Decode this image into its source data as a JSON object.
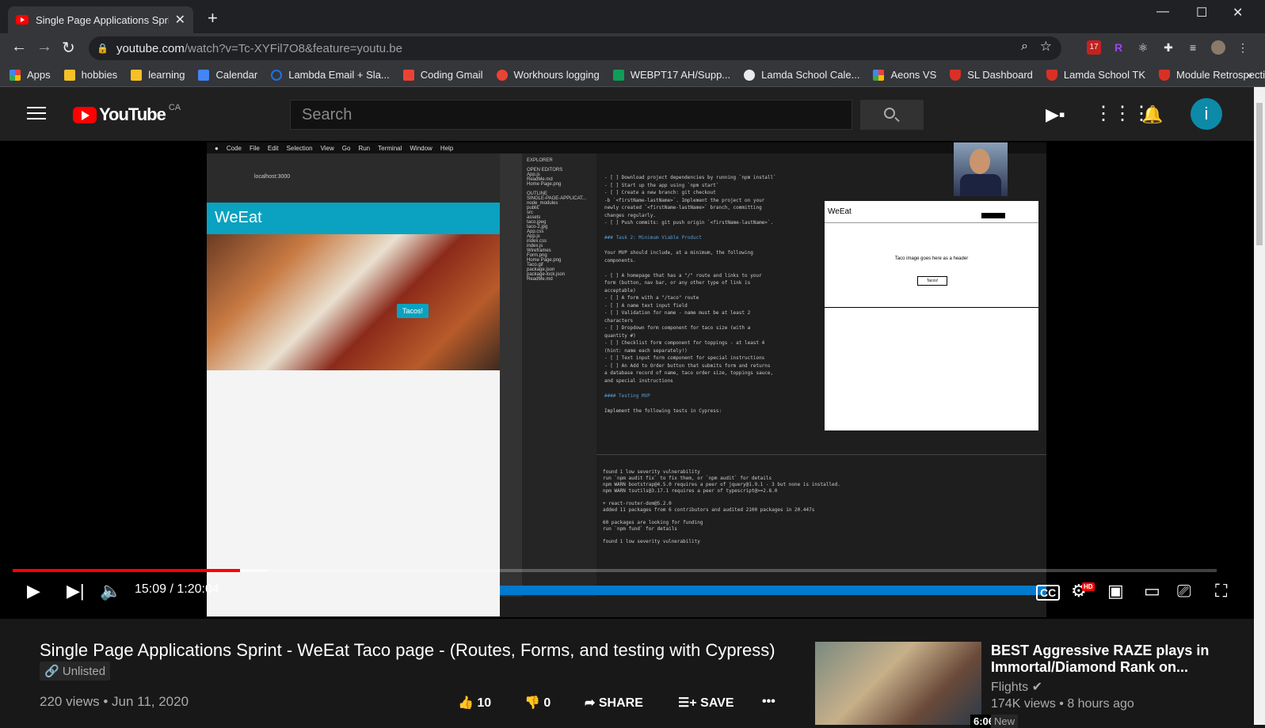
{
  "browser": {
    "tab_title": "Single Page Applications Sprint -",
    "url_host": "youtube.com",
    "url_path": "/watch?v=Tc-XYFil7O8&feature=youtu.be",
    "bookmarks": [
      {
        "label": "Apps",
        "color": "#4285f4"
      },
      {
        "label": "hobbies",
        "color": "#f6c026"
      },
      {
        "label": "learning",
        "color": "#f6c026"
      },
      {
        "label": "Calendar",
        "color": "#4285f4"
      },
      {
        "label": "Lambda Email + Sla...",
        "color": "#1a73e8"
      },
      {
        "label": "Coding Gmail",
        "color": "#ea4335"
      },
      {
        "label": "Workhours logging",
        "color": "#ea4335"
      },
      {
        "label": "WEBPT17 AH/Supp...",
        "color": "#0f9d58"
      },
      {
        "label": "Lamda School Cale...",
        "color": "#e8eaed"
      },
      {
        "label": "Aeons VS",
        "color": "#fbbc04"
      },
      {
        "label": "SL Dashboard",
        "color": "#d93025"
      },
      {
        "label": "Lamda School TK",
        "color": "#d93025"
      },
      {
        "label": "Module Retrospecti...",
        "color": "#d93025"
      }
    ],
    "ext_badge": "17"
  },
  "youtube": {
    "logo_text": "YouTube",
    "country": "CA",
    "search_placeholder": "Search",
    "avatar_letter": "i",
    "time_current": "15:09",
    "time_total": "1:20:04",
    "progress_fraction": 0.189,
    "buffered_fraction": 0.212,
    "video_title": "Single Page Applications Sprint - WeEat Taco page - (Routes, Forms, and testing with Cypress)",
    "unlisted": "Unlisted",
    "views_date": "220 views • Jun 11, 2020",
    "likes": "10",
    "dislikes": "0",
    "share": "SHARE",
    "save": "SAVE",
    "hd_badge": "HD"
  },
  "video_frame": {
    "app_title": "WeEat",
    "tacos_button": "Tacos!",
    "localhost": "localhost:3000",
    "preview_header": "Taco image goes here as a header",
    "preview_button": "Tacos!"
  },
  "recommended": {
    "title": "BEST Aggressive RAZE plays in Immortal/Diamond Rank on...",
    "channel": "Flights",
    "meta": "174K views • 8 hours ago",
    "badge": "New",
    "duration": "6:06"
  }
}
